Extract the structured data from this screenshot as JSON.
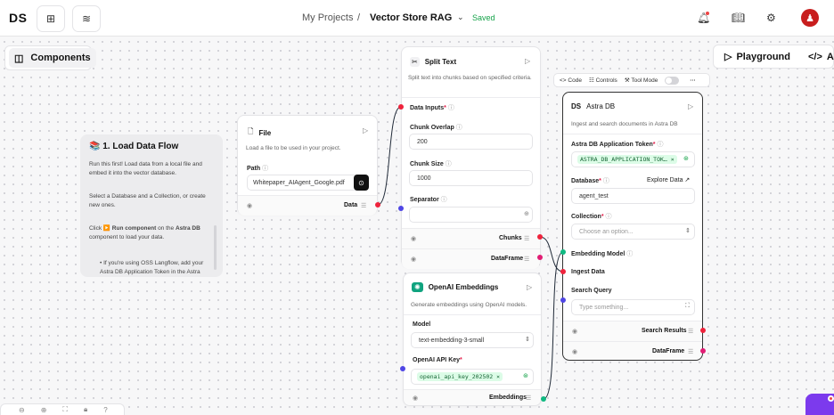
{
  "header": {
    "logo": "DS",
    "breadcrumb_parent": "My Projects",
    "separator": "/",
    "project_name": "Vector Store RAG",
    "status": "Saved"
  },
  "canvas": {
    "components_label": "Components",
    "playground_label": "Playground",
    "api_label": "API"
  },
  "note": {
    "title": "📚 1. Load Data Flow",
    "p1": "Run this first! Load data from a local file and embed it into the vector database.",
    "p2": "Select a Database and a Collection, or create new ones.",
    "p3_prefix": "Click ",
    "p3_bold": "▶️ Run component",
    "p3_mid": " on the ",
    "p3_bold2": "Astra DB",
    "p3_suffix": " component to load your data.",
    "p4": "• If you're using OSS Langflow, add your Astra DB Application Token in the Astra"
  },
  "file_node": {
    "title": "File",
    "description": "Load a file to be used in your project.",
    "path_label": "Path",
    "path_value": "Whitepaper_AIAgent_Google.pdf",
    "output": "Data"
  },
  "split_node": {
    "title": "Split Text",
    "description": "Split text into chunks based on specified criteria.",
    "data_inputs_label": "Data Inputs",
    "chunk_overlap_label": "Chunk Overlap",
    "chunk_overlap_value": "200",
    "chunk_size_label": "Chunk Size",
    "chunk_size_value": "1000",
    "separator_label": "Separator",
    "output_chunks": "Chunks",
    "output_dataframe": "DataFrame"
  },
  "openai_node": {
    "title": "OpenAI Embeddings",
    "description": "Generate embeddings using OpenAI models.",
    "model_label": "Model",
    "model_value": "text-embedding-3-small",
    "api_key_label": "OpenAI API Key",
    "api_key_value": "openai_api_key_202502",
    "output": "Embeddings"
  },
  "astra_toolbar": {
    "code": "Code",
    "controls": "Controls",
    "tool_mode": "Tool Mode",
    "more": "···"
  },
  "astra_node": {
    "title": "Astra DB",
    "description": "Ingest and search documents in Astra DB",
    "token_label": "Astra DB Application Token",
    "token_value": "ASTRA_DB_APPLICATION_TOK…",
    "database_label": "Database",
    "explore_label": "Explore Data",
    "database_value": "agent_test",
    "collection_label": "Collection",
    "collection_placeholder": "Choose an option...",
    "embedding_model_label": "Embedding Model",
    "ingest_label": "Ingest Data",
    "search_label": "Search Query",
    "search_placeholder": "Type something...",
    "output_search": "Search Results",
    "output_dataframe": "DataFrame"
  },
  "colors": {
    "data_handle": "#ef233c",
    "dataframe_handle": "#e11d74",
    "embedding_handle": "#10b981",
    "input_handle": "#4f46e5",
    "brand": "#7c3aed"
  }
}
